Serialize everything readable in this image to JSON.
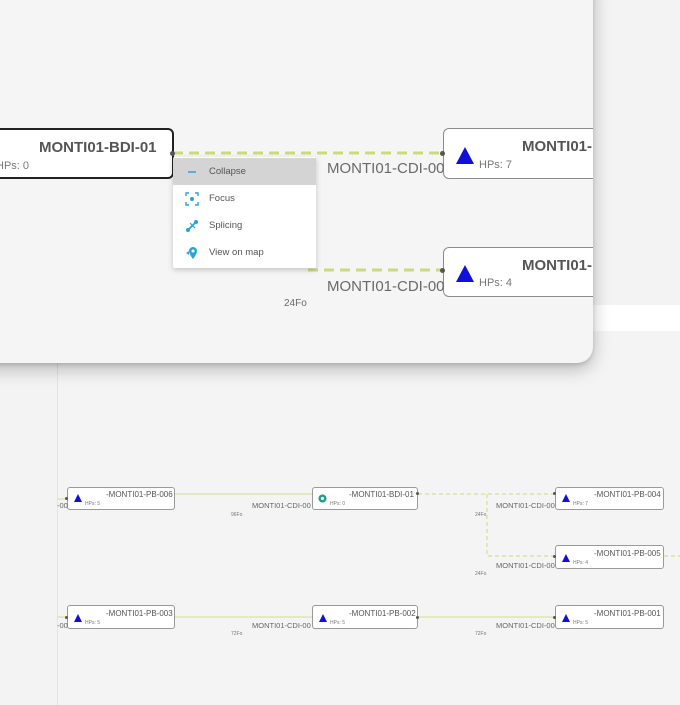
{
  "colors": {
    "edge": "#d2e08a",
    "edge_dashed": "#cdda7c",
    "hp_triangle": "#1010d8",
    "menu_icon": "#29a3dc",
    "selected_border": "#222222"
  },
  "foreground": {
    "source_node": {
      "name": "MONTI01-BDI-01",
      "hps": "HPs: 0"
    },
    "target_nodes": [
      {
        "name": "MONTI01-",
        "hps": "HPs: 7",
        "edge_label": "MONTI01-CDI-00"
      },
      {
        "name": "MONTI01-",
        "hps": "HPs: 4",
        "edge_label": "MONTI01-CDI-00"
      }
    ],
    "fiber_label": "24Fo"
  },
  "context_menu": {
    "items": [
      {
        "label": "Collapse",
        "icon": "minus-icon"
      },
      {
        "label": "Focus",
        "icon": "focus-icon"
      },
      {
        "label": "Splicing",
        "icon": "splice-icon"
      },
      {
        "label": "View on map",
        "icon": "map-pin-icon"
      }
    ]
  },
  "background": {
    "nodes": [
      {
        "name": "-MONTI01-PB-006",
        "hps": "HPs: 5",
        "icon": "triangle"
      },
      {
        "name": "-MONTI01-BDI-01",
        "hps": "HPs: 0",
        "icon": "gear"
      },
      {
        "name": "-MONTI01-PB-004",
        "hps": "HPs: 7",
        "icon": "triangle"
      },
      {
        "name": "-MONTI01-PB-005",
        "hps": "HPs: 4",
        "icon": "triangle"
      },
      {
        "name": "-MONTI01-PB-003",
        "hps": "HPs: 5",
        "icon": "triangle"
      },
      {
        "name": "-MONTI01-PB-002",
        "hps": "HPs: 5",
        "icon": "triangle"
      },
      {
        "name": "-MONTI01-PB-001",
        "hps": "HPs: 5",
        "icon": "triangle"
      }
    ],
    "edge_labels": [
      "-00",
      "MONTI01-CDI-00",
      "MONTI01-CDI-00",
      "MONTI01-CDI-00",
      "-00",
      "MONTI01-CDI-00",
      "MONTI01-CDI-00"
    ],
    "fiber_labels": [
      "96Fo",
      "24Fo",
      "24Fo",
      "72Fo",
      "72Fo"
    ]
  }
}
